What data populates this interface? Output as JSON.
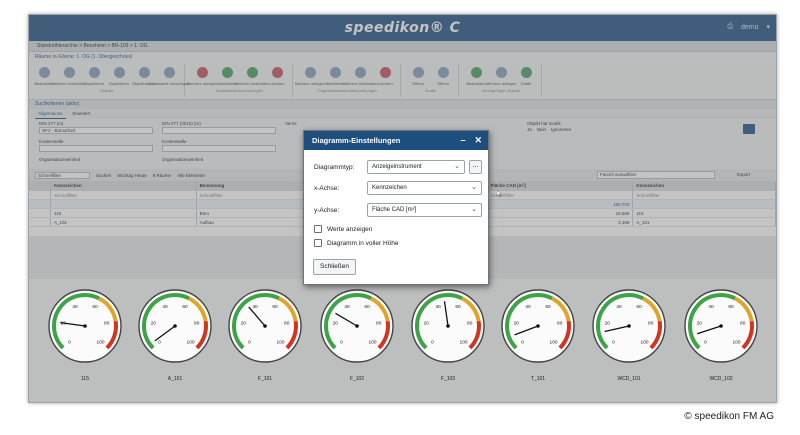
{
  "app": {
    "brand": "speedikon® C",
    "user": "demo"
  },
  "breadcrumb": "Standorthierarchie > Bensheim > BR-103 > 1. OG",
  "subtitle": "Räume zu Ebene: 1. OG (1. Obergeschoss)",
  "ribbon": {
    "groups": [
      {
        "name": "Objekte",
        "items": [
          {
            "label": "Bearbeiten",
            "color": "#8aa3bd"
          },
          {
            "label": "Mehrere bearbeiten",
            "color": "#8aa3bd"
          },
          {
            "label": "Duplizieren",
            "color": "#8aa3bd"
          },
          {
            "label": "Duplizieren",
            "color": "#8aa3bd"
          },
          {
            "label": "Objekthistorie",
            "color": "#8aa3bd"
          },
          {
            "label": "Zu Variante hinzufügen",
            "color": "#8aa3bd"
          }
        ]
      },
      {
        "name": "Kostenstellenzuordnungen",
        "items": [
          {
            "label": "Mehrere anlegen",
            "color": "#c35b63"
          },
          {
            "label": "Bearbeiten",
            "color": "#4fa36b"
          },
          {
            "label": "Mehrere bearbeiten",
            "color": "#4fa36b"
          },
          {
            "label": "Löschen",
            "color": "#c35b63"
          }
        ]
      },
      {
        "name": "Organisationseinheitzuordnungen",
        "items": [
          {
            "label": "Mehrere anlegen",
            "color": "#8aa3bd"
          },
          {
            "label": "Bearbeiten",
            "color": "#8aa3bd"
          },
          {
            "label": "Mehrere bearbeiten",
            "color": "#8aa3bd"
          },
          {
            "label": "Löschen",
            "color": "#c35b63"
          }
        ]
      },
      {
        "name": "Grafik",
        "items": [
          {
            "label": "Öffnen",
            "color": "#8aa3bd"
          },
          {
            "label": "Öffnen",
            "color": "#8aa3bd"
          }
        ]
      },
      {
        "name": "Hinzugefügte Objekte",
        "items": [
          {
            "label": "Bearbeiten",
            "color": "#4fa36b"
          },
          {
            "label": "Mehrere anlegen",
            "color": "#8aa3bd"
          },
          {
            "label": "Grafik",
            "color": "#4fa36b"
          }
        ]
      }
    ]
  },
  "section_title": "Suchkriterien (aktiv)",
  "tabs": [
    "Allgemeines",
    "Erweitert"
  ],
  "filters": {
    "din277_label": "DIN 277 (m)",
    "din277_value": "NF2 - Büroarbeit",
    "din277_2016_label": "DIN 277 (2016) (m)",
    "kostenstelle_label": "Kostenstelle",
    "kostenstelle2_label": "Kostenstelle",
    "orga_label": "Organisationseinheit",
    "orga2_label": "Organisationseinheit",
    "verm_label": "Vermi",
    "grafik_label": "Objekt hat Grafik",
    "grafik_ja": "Ja",
    "grafik_nein": "Nein",
    "grafik_ignorieren": "Ignorieren"
  },
  "searchbar": {
    "placeholder": "Schnellfilter",
    "search_btn": "Suchen",
    "stichtag": "Stichtag Heute",
    "count": "8 Räume",
    "alle": "Alle Elemente",
    "favorit": "Favorit auswählen",
    "export": "Export"
  },
  "grid": {
    "columns": [
      "Kennzeichen",
      "Benennung",
      "",
      "Fläche CAD [m²]",
      "Kennzeichen"
    ],
    "filter_placeholder": "Schnellfilter",
    "sum_value": "160,700",
    "rows": [
      [
        "115",
        "Büro",
        "",
        "19,565",
        "115"
      ],
      [
        "A_101",
        "Aufbau",
        "",
        "3,168",
        "A_101"
      ]
    ]
  },
  "dialog": {
    "title": "Diagramm-Einstellungen",
    "type_label": "Diagrammtyp:",
    "type_value": "Anzeigeinstrument",
    "dots": "...",
    "x_label": "x-Achse:",
    "x_value": "Kennzeichen",
    "y_label": "y-Achse:",
    "y_value": "Fläche CAD [m²]",
    "check1": "Werte anzeigen",
    "check2": "Diagramm in voller Höhe",
    "close_btn": "Schließen"
  },
  "chart_data": {
    "type": "gauge",
    "categories": [
      "115",
      "A_101",
      "F_101",
      "F_102",
      "F_103",
      "T_101",
      "WCD_101",
      "WCD_102"
    ],
    "values": [
      19.565,
      3.168,
      35,
      28,
      47,
      9,
      12,
      10
    ],
    "ylim": [
      0,
      100
    ],
    "ticks": [
      0,
      20,
      40,
      60,
      80,
      100
    ],
    "zones": [
      {
        "from": 0,
        "to": 60,
        "color": "#3ea346"
      },
      {
        "from": 60,
        "to": 80,
        "color": "#e0a526"
      },
      {
        "from": 80,
        "to": 100,
        "color": "#d2351f"
      }
    ]
  },
  "copyright": "© speedikon FM AG"
}
